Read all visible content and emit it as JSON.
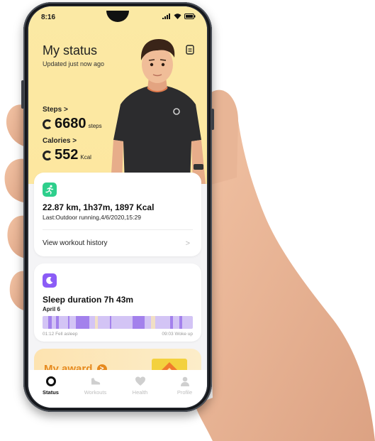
{
  "status_bar": {
    "time": "8:16"
  },
  "header": {
    "title": "My status",
    "subtitle": "Updated just now ago",
    "steps_label": "Steps >",
    "steps_value": "6680",
    "steps_unit": "steps",
    "calories_label": "Calories >",
    "calories_value": "552",
    "calories_unit": "Kcal"
  },
  "workout_card": {
    "summary": "22.87 km, 1h37m, 1897 Kcal",
    "last": "Last:Outdoor running,4/6/2020,15:29",
    "history_link": "View workout history",
    "chevron": ">"
  },
  "sleep_card": {
    "title": "Sleep duration 7h 43m",
    "date": "April 6",
    "start": "01:12 Fell asleep",
    "end": "09:03 Woke up",
    "segments": [
      {
        "level": "light",
        "share": 4
      },
      {
        "level": "deep",
        "share": 2
      },
      {
        "level": "light",
        "share": 3
      },
      {
        "level": "deep",
        "share": 2
      },
      {
        "level": "light",
        "share": 6
      },
      {
        "level": "deep",
        "share": 1
      },
      {
        "level": "light",
        "share": 4
      },
      {
        "level": "deep",
        "share": 9
      },
      {
        "level": "light",
        "share": 4
      },
      {
        "level": "awake",
        "share": 2
      },
      {
        "level": "light",
        "share": 8
      },
      {
        "level": "deep",
        "share": 1
      },
      {
        "level": "light",
        "share": 14
      },
      {
        "level": "deep",
        "share": 8
      },
      {
        "level": "light",
        "share": 4
      },
      {
        "level": "awake",
        "share": 3
      },
      {
        "level": "light",
        "share": 10
      },
      {
        "level": "deep",
        "share": 2
      },
      {
        "level": "light",
        "share": 4
      },
      {
        "level": "deep",
        "share": 2
      },
      {
        "level": "light",
        "share": 7
      }
    ]
  },
  "award_card": {
    "title": "My award",
    "arrow": ">"
  },
  "bottom_nav": [
    {
      "label": "Status",
      "icon": "status-ring-icon",
      "active": true
    },
    {
      "label": "Workouts",
      "icon": "running-shoe-icon",
      "active": false
    },
    {
      "label": "Health",
      "icon": "heart-icon",
      "active": false
    },
    {
      "label": "Profile",
      "icon": "person-icon",
      "active": false
    }
  ],
  "colors": {
    "header_bg": "#fde7a0",
    "workout_icon_bg": "#2ecf8c",
    "sleep_icon_bg": "#8b5cf6",
    "sleep_light": "#d3c4f5",
    "sleep_deep": "#a381ec",
    "sleep_awake": "#f1dfc4",
    "award_orange": "#e68a1e"
  }
}
